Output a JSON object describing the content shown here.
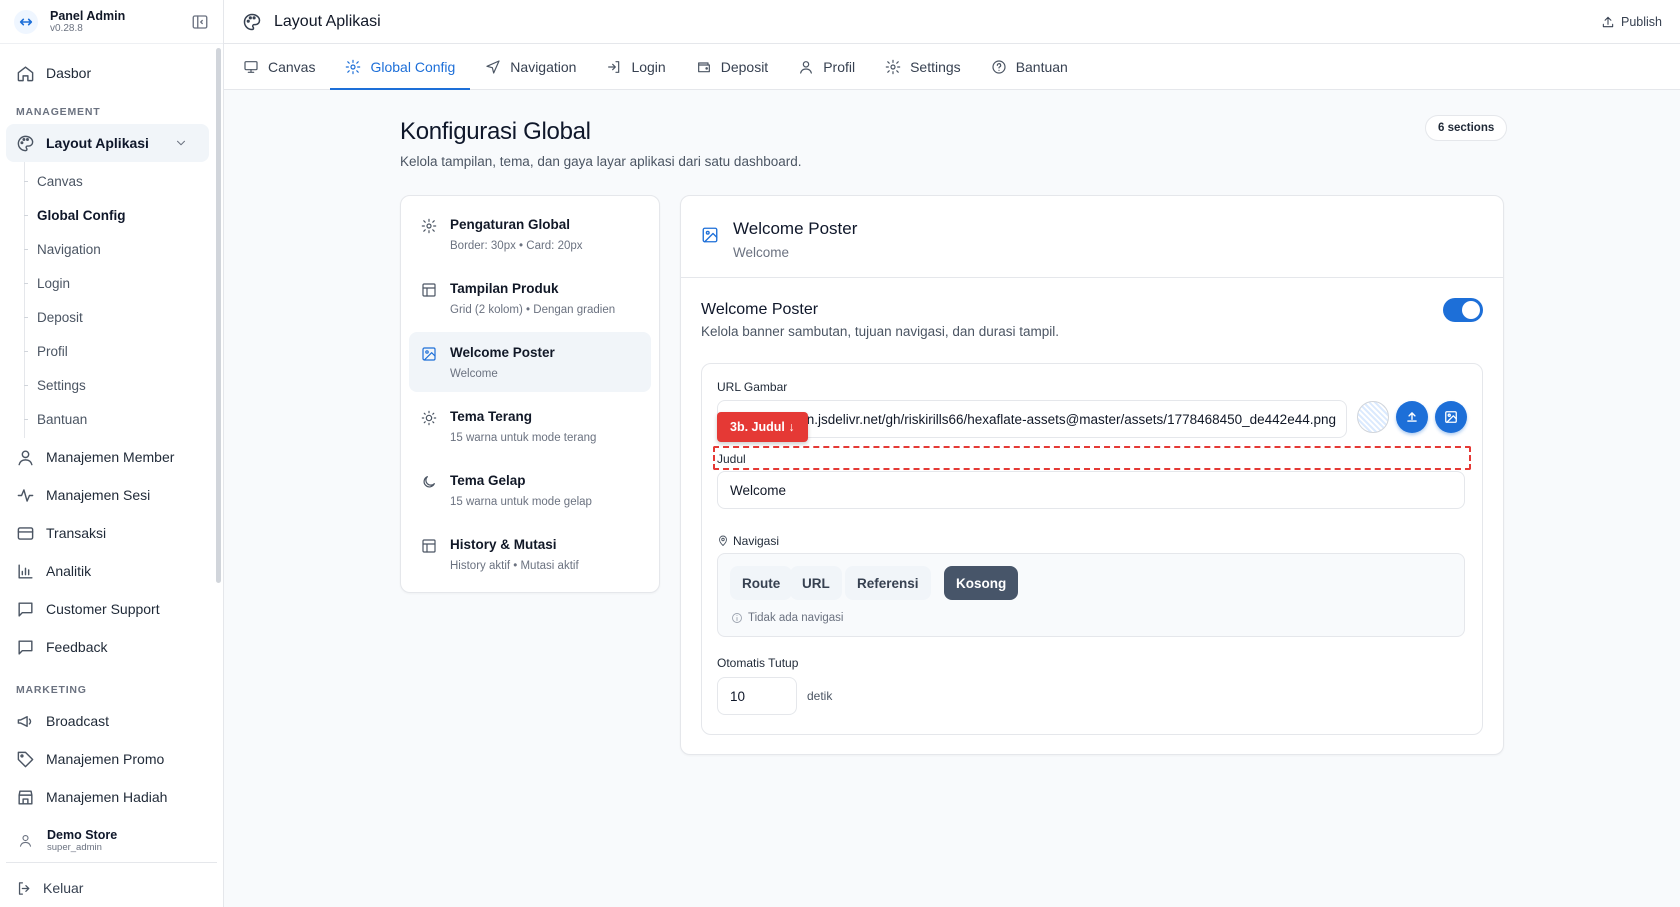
{
  "brand": {
    "name": "Panel Admin",
    "version": "v0.28.8"
  },
  "sidebar": {
    "dashboard": "Dasbor",
    "management_label": "MANAGEMENT",
    "layout_group": "Layout Aplikasi",
    "layout_sub": [
      "Canvas",
      "Global Config",
      "Navigation",
      "Login",
      "Deposit",
      "Profil",
      "Settings",
      "Bantuan"
    ],
    "management_items": [
      {
        "label": "Manajemen Member",
        "icon": "user-icon"
      },
      {
        "label": "Manajemen Sesi",
        "icon": "activity-icon"
      },
      {
        "label": "Transaksi",
        "icon": "card-icon"
      },
      {
        "label": "Analitik",
        "icon": "chart-icon"
      },
      {
        "label": "Customer Support",
        "icon": "message-icon"
      },
      {
        "label": "Feedback",
        "icon": "message-icon"
      }
    ],
    "marketing_label": "MARKETING",
    "marketing_items": [
      {
        "label": "Broadcast",
        "icon": "megaphone-icon"
      },
      {
        "label": "Manajemen Promo",
        "icon": "tag-icon"
      },
      {
        "label": "Manajemen Hadiah",
        "icon": "store-icon"
      }
    ],
    "user": {
      "name": "Demo Store",
      "role": "super_admin"
    },
    "logout": "Keluar"
  },
  "header": {
    "title": "Layout Aplikasi",
    "publish": "Publish"
  },
  "tabs": [
    {
      "label": "Canvas",
      "icon": "monitor-icon"
    },
    {
      "label": "Global Config",
      "icon": "gear-icon",
      "active": true
    },
    {
      "label": "Navigation",
      "icon": "navigation-icon"
    },
    {
      "label": "Login",
      "icon": "login-icon"
    },
    {
      "label": "Deposit",
      "icon": "wallet-icon"
    },
    {
      "label": "Profil",
      "icon": "user-icon"
    },
    {
      "label": "Settings",
      "icon": "gear-icon"
    },
    {
      "label": "Bantuan",
      "icon": "help-icon"
    }
  ],
  "main": {
    "title": "Konfigurasi Global",
    "subtitle": "Kelola tampilan, tema, dan gaya layar aplikasi dari satu dashboard.",
    "sections_badge": "6 sections",
    "sections": [
      {
        "name": "Pengaturan Global",
        "desc": "Border: 30px • Card: 20px",
        "icon": "gear-icon"
      },
      {
        "name": "Tampilan Produk",
        "desc": "Grid (2 kolom) • Dengan gradien",
        "icon": "layout-icon"
      },
      {
        "name": "Welcome Poster",
        "desc": "Welcome",
        "icon": "image-icon",
        "active": true
      },
      {
        "name": "Tema Terang",
        "desc": "15 warna untuk mode terang",
        "icon": "sun-icon"
      },
      {
        "name": "Tema Gelap",
        "desc": "15 warna untuk mode gelap",
        "icon": "moon-icon"
      },
      {
        "name": "History & Mutasi",
        "desc": "History aktif • Mutasi aktif",
        "icon": "layout-icon"
      }
    ]
  },
  "panel": {
    "title": "Welcome Poster",
    "subtitle": "Welcome",
    "section_title": "Welcome Poster",
    "section_desc": "Kelola banner sambutan, tujuan navigasi, dan durasi tampil.",
    "enabled": true,
    "url_label": "URL Gambar",
    "url_value": "https://cdn.jsdelivr.net/gh/riskirills66/hexaflate-assets@master/assets/1778468450_de442e44.png",
    "badge": "3b. Judul ↓",
    "judul_label": "Judul",
    "judul_value": "Welcome",
    "nav_label": "Navigasi",
    "nav_options": [
      "Route",
      "URL",
      "Referensi",
      "Kosong"
    ],
    "nav_selected": "Kosong",
    "nav_note": "Tidak ada navigasi",
    "auto_label": "Otomatis Tutup",
    "auto_value": "10",
    "auto_unit": "detik"
  },
  "colors": {
    "accent": "#1d6fd8",
    "highlight": "#e53935",
    "segment_active": "#475569"
  }
}
